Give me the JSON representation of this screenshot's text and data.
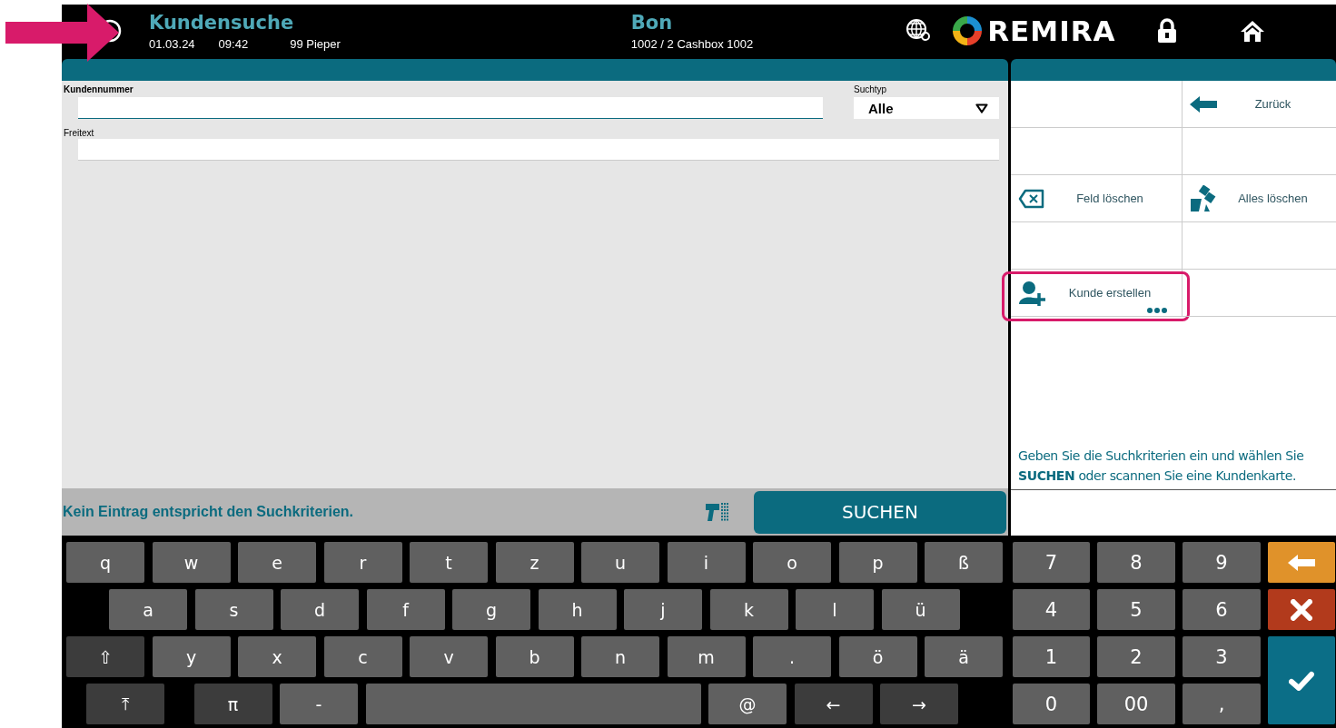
{
  "annotation": {
    "kind": "arrow"
  },
  "header": {
    "title": "Kundensuche",
    "date": "01.03.24",
    "time": "09:42",
    "user": "99 Pieper",
    "doc_title": "Bon",
    "doc_info": "1002 / 2 Cashbox 1002",
    "logo_text": "REMIRA"
  },
  "search_form": {
    "fields": [
      {
        "label": "Kundennummer",
        "focused": true
      },
      {
        "label": "Freitext",
        "focused": false
      }
    ],
    "search_type": {
      "label": "Suchtyp",
      "value": "Alle"
    }
  },
  "status": {
    "message": "Kein Eintrag entspricht den Suchkriterien.",
    "search_button": "SUCHEN"
  },
  "action_grid": [
    [
      {
        "kind": "empty"
      },
      {
        "kind": "back",
        "label": "Zurück",
        "highlighted": false
      }
    ],
    [
      {
        "kind": "empty"
      },
      {
        "kind": "empty"
      }
    ],
    [
      {
        "kind": "clear_field",
        "label": "Feld löschen",
        "highlighted": false
      },
      {
        "kind": "clear_all",
        "label": "Alles löschen",
        "highlighted": false
      }
    ],
    [
      {
        "kind": "empty"
      },
      {
        "kind": "empty"
      }
    ],
    [
      {
        "kind": "new_customer",
        "label": "Kunde erstellen",
        "more": true,
        "highlighted": true
      },
      {
        "kind": "empty"
      }
    ]
  ],
  "help_text": "Geben Sie die Suchkriterien ein und wählen Sie **SUCHEN** oder scannen Sie eine Kundenkarte.",
  "keyboard": [
    [
      {
        "label": "q",
        "kind": "char"
      },
      {
        "label": "w",
        "kind": "char"
      },
      {
        "label": "e",
        "kind": "char"
      },
      {
        "label": "r",
        "kind": "char"
      },
      {
        "label": "t",
        "kind": "char"
      },
      {
        "label": "z",
        "kind": "char"
      },
      {
        "label": "u",
        "kind": "char"
      },
      {
        "label": "i",
        "kind": "char"
      },
      {
        "label": "o",
        "kind": "char"
      },
      {
        "label": "p",
        "kind": "char"
      },
      {
        "label": "ß",
        "kind": "char"
      }
    ],
    [
      {
        "label": "a",
        "kind": "char"
      },
      {
        "label": "s",
        "kind": "char"
      },
      {
        "label": "d",
        "kind": "char"
      },
      {
        "label": "f",
        "kind": "char"
      },
      {
        "label": "g",
        "kind": "char"
      },
      {
        "label": "h",
        "kind": "char"
      },
      {
        "label": "j",
        "kind": "char"
      },
      {
        "label": "k",
        "kind": "char"
      },
      {
        "label": "l",
        "kind": "char"
      },
      {
        "label": "ü",
        "kind": "char"
      }
    ],
    [
      {
        "label": "⇧",
        "kind": "function"
      },
      {
        "label": "y",
        "kind": "char"
      },
      {
        "label": "x",
        "kind": "char"
      },
      {
        "label": "c",
        "kind": "char"
      },
      {
        "label": "v",
        "kind": "char"
      },
      {
        "label": "b",
        "kind": "char"
      },
      {
        "label": "n",
        "kind": "char"
      },
      {
        "label": "m",
        "kind": "char"
      },
      {
        "label": ".",
        "kind": "char"
      },
      {
        "label": "ö",
        "kind": "char"
      },
      {
        "label": "ä",
        "kind": "char"
      }
    ],
    [
      {
        "label": "⤒",
        "kind": "function"
      },
      {
        "label": "π",
        "kind": "function"
      },
      {
        "label": "-",
        "kind": "char"
      },
      {
        "kind": "space"
      },
      {
        "label": "@",
        "kind": "char"
      },
      {
        "label": "←",
        "kind": "function"
      },
      {
        "label": "→",
        "kind": "function"
      }
    ]
  ],
  "numpad": [
    [
      {
        "label": "7",
        "kind": "digit"
      },
      {
        "label": "8",
        "kind": "digit"
      },
      {
        "label": "9",
        "kind": "digit"
      },
      {
        "kind": "backspace"
      }
    ],
    [
      {
        "label": "4",
        "kind": "digit"
      },
      {
        "label": "5",
        "kind": "digit"
      },
      {
        "label": "6",
        "kind": "digit"
      },
      {
        "kind": "cancel"
      }
    ],
    [
      {
        "label": "1",
        "kind": "digit"
      },
      {
        "label": "2",
        "kind": "digit"
      },
      {
        "label": "3",
        "kind": "digit"
      },
      {
        "kind": "confirm"
      }
    ],
    [
      {
        "label": "0",
        "kind": "digit"
      },
      {
        "label": "00",
        "kind": "digit"
      },
      {
        "label": ",",
        "kind": "digit"
      }
    ]
  ]
}
